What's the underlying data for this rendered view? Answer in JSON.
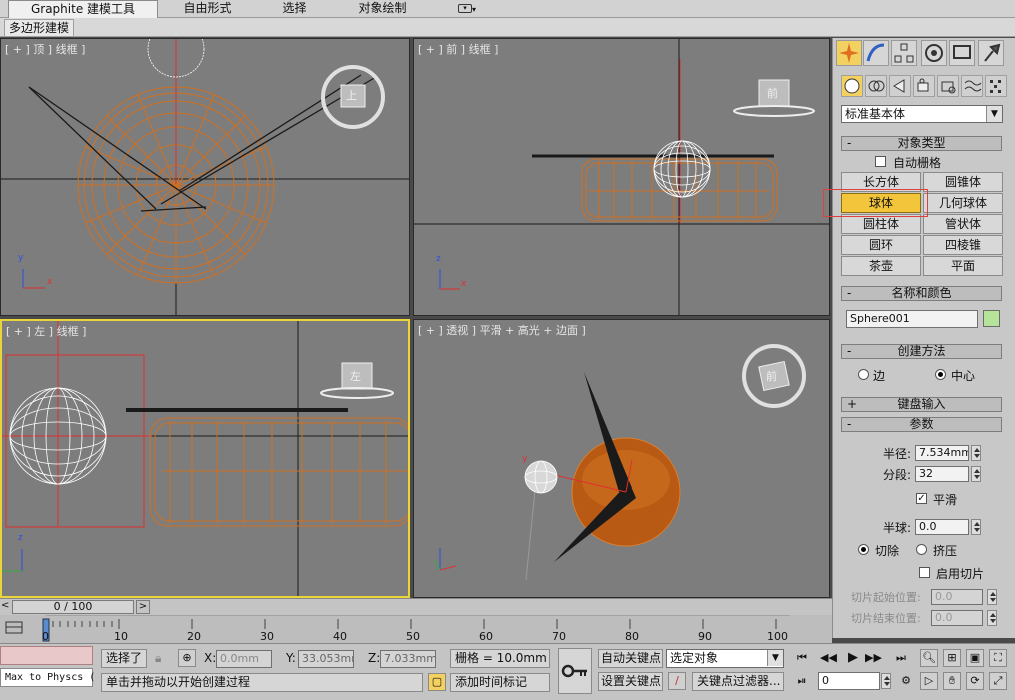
{
  "ribbon": {
    "tabs": [
      "Graphite 建模工具",
      "自由形式",
      "选择",
      "对象绘制"
    ],
    "sub": "多边形建模"
  },
  "viewports": [
    {
      "label": "[ + ] 顶 ] 线框 ]",
      "nav": "上"
    },
    {
      "label": "[ + ] 前 ] 线框 ]",
      "nav": "前"
    },
    {
      "label": "[ + ] 左 ] 线框 ]",
      "nav": "左"
    },
    {
      "label": "[ + ] 透视 ] 平滑 + 高光 + 边面 ]",
      "nav": "前"
    }
  ],
  "axes": {
    "x": "x",
    "y": "y",
    "z": "z"
  },
  "panel": {
    "category": "标准基本体",
    "object_type": {
      "title": "对象类型",
      "auto_grid": "自动栅格",
      "buttons": [
        "长方体",
        "圆锥体",
        "球体",
        "几何球体",
        "圆柱体",
        "管状体",
        "圆环",
        "四棱锥",
        "茶壶",
        "平面"
      ]
    },
    "name_color": {
      "title": "名称和颜色",
      "name": "Sphere001",
      "color": "#b6e39a"
    },
    "create_method": {
      "title": "创建方法",
      "edge": "边",
      "center": "中心"
    },
    "keyboard": {
      "title": "键盘输入"
    },
    "params": {
      "title": "参数",
      "radius_label": "半径:",
      "radius": "7.534mm",
      "segments_label": "分段:",
      "segments": "32",
      "smooth": "平滑",
      "hemi_label": "半球:",
      "hemi": "0.0",
      "chop": "切除",
      "squash": "挤压",
      "enable_slice": "启用切片",
      "slice_from_label": "切片起始位置:",
      "slice_from": "0.0",
      "slice_to_label": "切片结束位置:",
      "slice_to": "0.0"
    },
    "minus": "-",
    "plus": "+"
  },
  "timeline": {
    "current": "0 / 100",
    "ticks": [
      "0",
      "10",
      "20",
      "30",
      "40",
      "50",
      "60",
      "70",
      "80",
      "90",
      "100"
    ]
  },
  "status": {
    "maxscript": "Max to Physcs (",
    "selected": "选择了",
    "x_label": "X:",
    "x": "0.0mm",
    "y_label": "Y:",
    "y": "33.053mm",
    "z_label": "Z:",
    "z": "7.033mm",
    "grid": "栅格 = 10.0mm",
    "auto_key": "自动关键点",
    "selected_object": "选定对象",
    "prompt": "单击并拖动以开始创建过程",
    "add_time_tag": "添加时间标记",
    "set_key": "设置关键点",
    "key_filters": "关键点过滤器...",
    "frame": "0"
  }
}
